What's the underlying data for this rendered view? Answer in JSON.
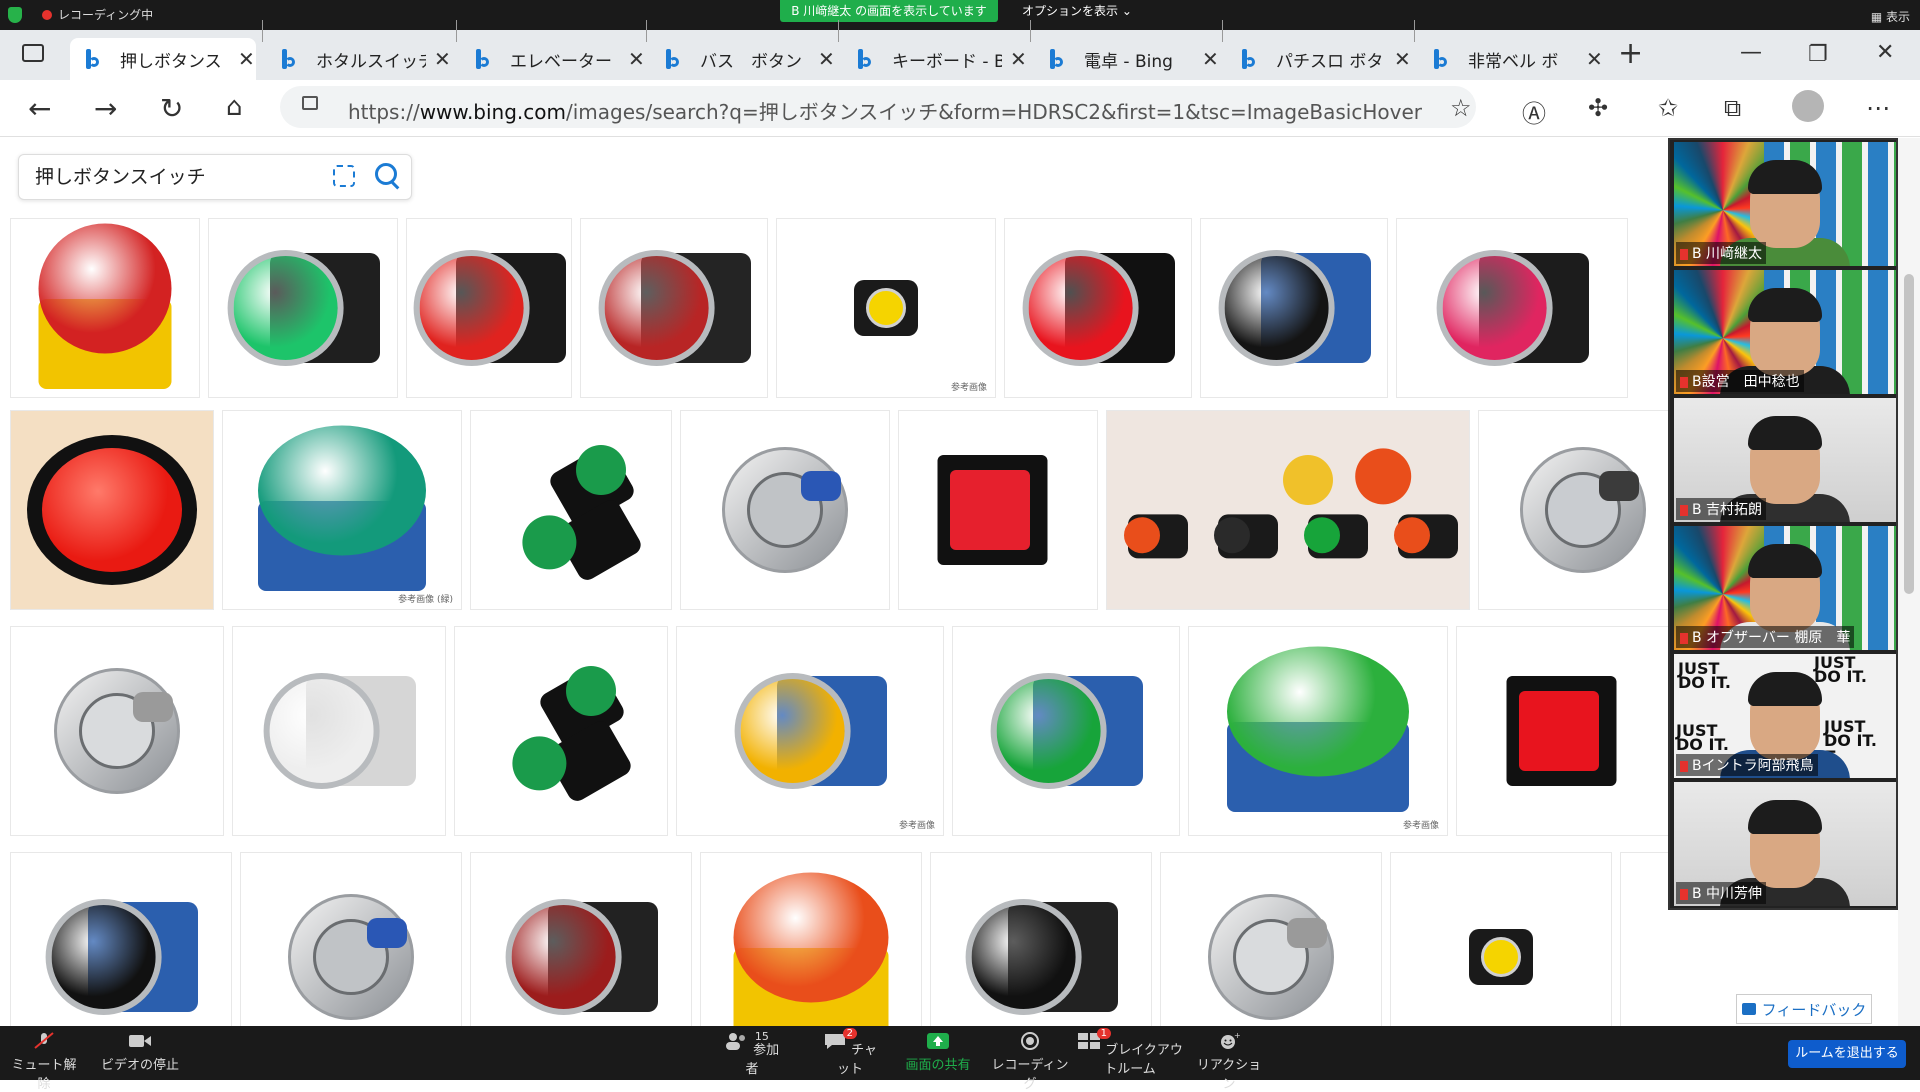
{
  "zoom_top": {
    "recording_label": "レコーディング中",
    "share_banner": "B 川﨑継太 の画面を表示しています",
    "options_label": "オプションを表示 ⌄",
    "view_label": "▦ 表示"
  },
  "browser": {
    "tabs": [
      {
        "title": "押しボタンス",
        "active": true
      },
      {
        "title": "ホタルスイッチ",
        "active": false
      },
      {
        "title": "エレベーター",
        "active": false
      },
      {
        "title": "バス　ボタン",
        "active": false
      },
      {
        "title": "キーボード - B",
        "active": false
      },
      {
        "title": "電卓 - Bing",
        "active": false
      },
      {
        "title": "パチスロ ボタ",
        "active": false
      },
      {
        "title": "非常ベル ボ",
        "active": false
      }
    ],
    "url_prefix": "https://",
    "url_host": "www.bing.com",
    "url_path": "/images/search?q=押しボタンスイッチ&form=HDRSC2&first=1&tsc=ImageBasicHover"
  },
  "search": {
    "query": "押しボタンスイッチ"
  },
  "image_grid": {
    "rows": [
      [
        {
          "cap": "#d32222",
          "body": "#f2c400",
          "kind": "dome"
        },
        {
          "cap": "#1dc46a",
          "body": "#1f1f1f",
          "kind": "flat"
        },
        {
          "cap": "#e0231f",
          "body": "#1a1a1a",
          "kind": "flat"
        },
        {
          "cap": "#b82525",
          "body": "#242424",
          "kind": "flat"
        },
        {
          "cap": "#f5d400",
          "body": "#1a1a1a",
          "kind": "small",
          "mark": "参考画像"
        },
        {
          "cap": "#e8141e",
          "body": "#111111",
          "kind": "flat"
        },
        {
          "cap": "#141414",
          "body": "#2b5fae",
          "kind": "flat"
        },
        {
          "cap": "#e02560",
          "body": "#1c1c1c",
          "kind": "flat"
        }
      ],
      [
        {
          "cap": "#e91a12",
          "body": "#111111",
          "kind": "big",
          "bg": "#f4dfc3"
        },
        {
          "cap": "#139a7b",
          "body": "#2b5fae",
          "kind": "dome",
          "mark": "参考画像 (緑)"
        },
        {
          "cap": "#1a9b4b",
          "body": "#111111",
          "kind": "pair"
        },
        {
          "cap": "#c0c3c6",
          "body": "#2a57b5",
          "kind": "metal"
        },
        {
          "cap": "#e6202d",
          "body": "#111111",
          "kind": "square"
        },
        {
          "cap": "#f0c12a",
          "body": "#2a2a2a",
          "kind": "group",
          "bg": "#efe6e0"
        },
        {
          "cap": "#c9ccd0",
          "body": "#3b3b3b",
          "kind": "metal"
        }
      ],
      [
        {
          "cap": "#d9dbdd",
          "body": "#9a9a9a",
          "kind": "metal"
        },
        {
          "cap": "#eeeeee",
          "body": "#d6d6d6",
          "kind": "flat"
        },
        {
          "cap": "#1a9b4b",
          "body": "#111111",
          "kind": "pair"
        },
        {
          "cap": "#f2b100",
          "body": "#2b5fae",
          "kind": "flat",
          "mark": "参考画像"
        },
        {
          "cap": "#17a43a",
          "body": "#2b5fae",
          "kind": "flat"
        },
        {
          "cap": "#2cb03d",
          "body": "#2b5fae",
          "kind": "dome",
          "mark": "参考画像"
        },
        {
          "cap": "#e8141e",
          "body": "#111111",
          "kind": "square"
        }
      ],
      [
        {
          "cap": "#111111",
          "body": "#2b5fae",
          "kind": "flat"
        },
        {
          "cap": "#c0c3c6",
          "body": "#2a57b5",
          "kind": "metal"
        },
        {
          "cap": "#9c1c1c",
          "body": "#222222",
          "kind": "flat"
        },
        {
          "cap": "#e94e1b",
          "body": "#f2c400",
          "kind": "dome"
        },
        {
          "cap": "#111111",
          "body": "#222222",
          "kind": "flat"
        },
        {
          "cap": "#d9dbdd",
          "body": "#9a9a9a",
          "kind": "metal"
        },
        {
          "cap": "#f5d400",
          "body": "#1a1a1a",
          "kind": "small"
        },
        {
          "cap": "#c9ccd0",
          "body": "#3b3b3b",
          "kind": "metal"
        }
      ]
    ]
  },
  "participants": [
    {
      "name": "B 川﨑継太",
      "shirt": "#4a8c3a",
      "bg": "sdg"
    },
    {
      "name": "B設営　田中稔也",
      "shirt": "#1e1e1e",
      "bg": "sdg"
    },
    {
      "name": "B 吉村拓朗",
      "shirt": "#2f2f2f",
      "bg": "plain"
    },
    {
      "name": "B オブザーバー 棚原　華",
      "shirt": "#e8e8e8",
      "bg": "sdg"
    },
    {
      "name": "Bイントラ阿部飛鳥",
      "shirt": "#1f4e8c",
      "bg": "justdoit"
    },
    {
      "name": "B 中川芳伸",
      "shirt": "#2a2a2a",
      "bg": "plain"
    }
  ],
  "justdoit_text": "JUST DO IT.",
  "feedback_label": "フィードバック",
  "zoom_bottom": {
    "mute": "ミュート解除",
    "video": "ビデオの停止",
    "participants": "参加者",
    "participants_count": "15",
    "chat": "チャット",
    "chat_badge": "2",
    "share": "画面の共有",
    "record": "レコーディング",
    "breakout": "ブレイクアウトルーム",
    "breakout_badge": "1",
    "reaction": "リアクション",
    "leave": "ルームを退出する"
  },
  "colors": {
    "zoom_green": "#1fae4b",
    "bing_blue": "#1b7bd4",
    "leave_blue": "#0e5ccc"
  }
}
